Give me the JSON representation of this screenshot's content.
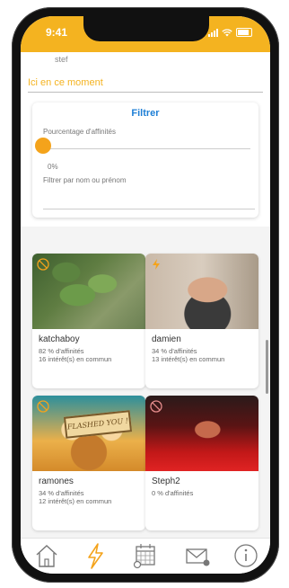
{
  "status": {
    "time": "9:41"
  },
  "profile": {
    "username": "stef"
  },
  "section": {
    "title": "Ici en ce moment"
  },
  "filter": {
    "title": "Filtrer",
    "affinity_label": "Pourcentage d'affinités",
    "affinity_value": "0%",
    "affinity_level": 0,
    "name_filter_label": "Filtrer par nom ou prénom",
    "name_filter_value": ""
  },
  "users": [
    {
      "name": "katchaboy",
      "affinity": "82 % d'affinités",
      "common": "16 intérêt(s) en commun"
    },
    {
      "name": "damien",
      "affinity": "34 % d'affinités",
      "common": "13 intérêt(s) en commun"
    },
    {
      "name": "ramones",
      "affinity": "34 % d'affinités",
      "common": "12 intérêt(s) en commun",
      "image_text": "FLASHED YOU !"
    },
    {
      "name": "Steph2",
      "affinity": "0 % d'affinités",
      "common": ""
    }
  ],
  "tabs": [
    {
      "icon": "home-icon"
    },
    {
      "icon": "lightning-icon",
      "active": true
    },
    {
      "icon": "calendar-icon"
    },
    {
      "icon": "mail-icon"
    },
    {
      "icon": "info-icon"
    }
  ],
  "colors": {
    "accent": "#f4b320",
    "link": "#1e7fd6",
    "active_tab": "#f4a31b"
  }
}
